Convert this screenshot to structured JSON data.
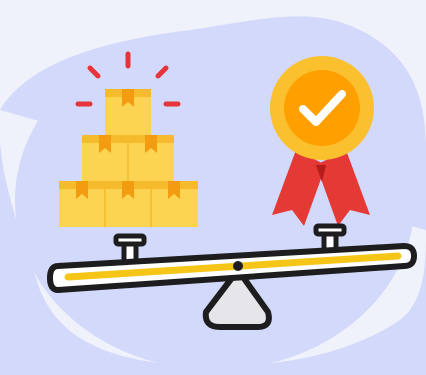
{
  "illustration": {
    "icons": [
      "boxes-stack-icon",
      "quality-badge-icon",
      "checkmark-icon",
      "seesaw-scale-icon"
    ],
    "colors": {
      "page_bg": "#eff1fb",
      "blob": "#d3d9fa",
      "box_light": "#fdd452",
      "box_dark": "#f6ba2d",
      "box_tape": "#f39c12",
      "burst": "#e6343a",
      "medal_outer": "#fbc02d",
      "medal_inner": "#ff9f00",
      "ribbon": "#e53935",
      "ribbon_dark": "#b71c1c",
      "check": "#ffffff",
      "beam": "#ffffff",
      "beam_stripe": "#f5c518",
      "outline": "#1d1d1f",
      "fulcrum": "#e6e6ea"
    }
  }
}
